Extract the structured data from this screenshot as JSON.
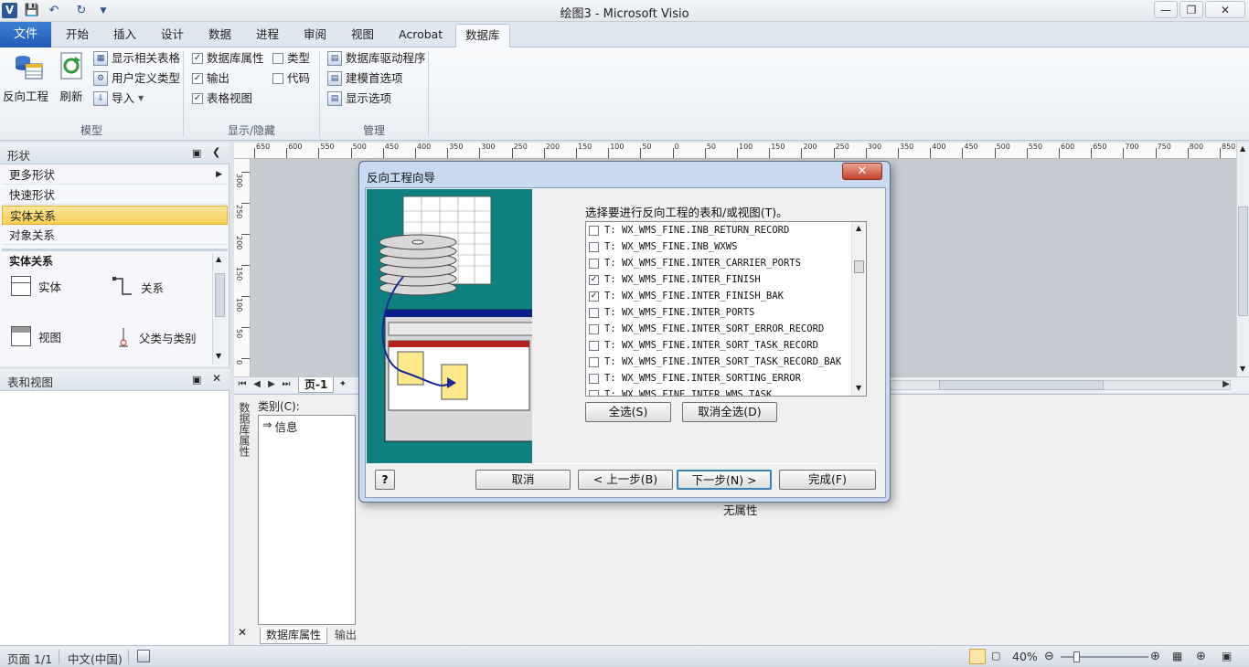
{
  "window": {
    "title": "绘图3 - Microsoft Visio",
    "app_icon": "V"
  },
  "quick_access": [
    "save-icon",
    "undo-icon",
    "redo-icon",
    "customize-icon"
  ],
  "ribbon_tabs": {
    "file": "文件",
    "items": [
      "开始",
      "插入",
      "设计",
      "数据",
      "进程",
      "审阅",
      "视图",
      "Acrobat",
      "数据库"
    ],
    "active": "数据库"
  },
  "ribbon": {
    "model": {
      "reverse": "反向工程",
      "refresh": "刷新",
      "show_related": "显示相关表格",
      "user_types": "用户定义类型",
      "import": "导入",
      "label": "模型"
    },
    "show_hide": {
      "db_props": "数据库属性",
      "types": "类型",
      "output": "输出",
      "code": "代码",
      "table_view": "表格视图",
      "label": "显示/隐藏"
    },
    "manage": {
      "drivers": "数据库驱动程序",
      "modeling_prefs": "建模首选项",
      "display_opts": "显示选项",
      "label": "管理"
    }
  },
  "shapes_pane": {
    "title": "形状",
    "more_shapes": "更多形状",
    "quick_shapes": "快速形状",
    "entity_relationship": "实体关系",
    "object_relational": "对象关系",
    "stencil_title": "实体关系",
    "shapes": [
      "实体",
      "关系",
      "视图",
      "父类与类别"
    ]
  },
  "tables_pane": {
    "title": "表和视图"
  },
  "ruler": {
    "h_ticks": [
      "650",
      "600",
      "550",
      "500",
      "450",
      "400",
      "350",
      "300",
      "250",
      "200",
      "150",
      "100",
      "50",
      "0",
      "50",
      "100",
      "150",
      "200",
      "250",
      "300",
      "350",
      "400",
      "450",
      "500",
      "550",
      "600",
      "650",
      "700",
      "750",
      "800",
      "850"
    ],
    "v_ticks": [
      "300",
      "250",
      "200",
      "150",
      "100",
      "50",
      "0"
    ]
  },
  "page_tab": "页-1",
  "properties": {
    "side_label": "数据库属性",
    "category_label": "类别(C):",
    "category_item": "信息",
    "no_props": "无属性",
    "tabs": [
      "数据库属性",
      "输出"
    ]
  },
  "dialog": {
    "title": "反向工程向导",
    "prompt": "选择要进行反向工程的表和/或视图(T)。",
    "tables": [
      {
        "checked": false,
        "name": "T:  WX_WMS_FINE.INB_RETURN_RECORD"
      },
      {
        "checked": false,
        "name": "T:  WX_WMS_FINE.INB_WXWS"
      },
      {
        "checked": false,
        "name": "T:  WX_WMS_FINE.INTER_CARRIER_PORTS"
      },
      {
        "checked": true,
        "name": "T:  WX_WMS_FINE.INTER_FINISH"
      },
      {
        "checked": true,
        "name": "T:  WX_WMS_FINE.INTER_FINISH_BAK"
      },
      {
        "checked": false,
        "name": "T:  WX_WMS_FINE.INTER_PORTS"
      },
      {
        "checked": false,
        "name": "T:  WX_WMS_FINE.INTER_SORT_ERROR_RECORD"
      },
      {
        "checked": false,
        "name": "T:  WX_WMS_FINE.INTER_SORT_TASK_RECORD"
      },
      {
        "checked": false,
        "name": "T:  WX_WMS_FINE.INTER_SORT_TASK_RECORD_BAK"
      },
      {
        "checked": false,
        "name": "T:  WX_WMS_FINE.INTER_SORTING_ERROR"
      },
      {
        "checked": false,
        "name": "T:  WX_WMS_FINE.INTER_WMS_TASK"
      }
    ],
    "select_all": "全选(S)",
    "deselect_all": "取消全选(D)",
    "help": "?",
    "cancel": "取消",
    "back": "< 上一步(B)",
    "next": "下一步(N) >",
    "finish": "完成(F)"
  },
  "status": {
    "page": "页面 1/1",
    "language": "中文(中国)",
    "zoom": "40%"
  }
}
